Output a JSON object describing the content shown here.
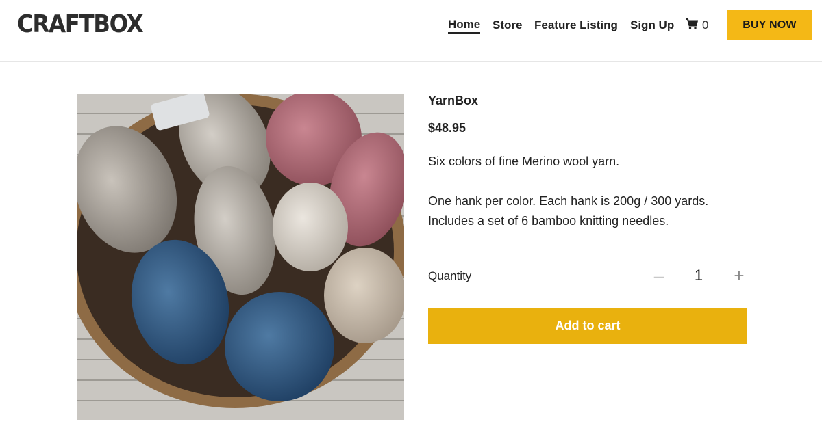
{
  "brand": {
    "logo_text": "CRAFTBOX"
  },
  "nav": {
    "items": [
      {
        "label": "Home"
      },
      {
        "label": "Store"
      },
      {
        "label": "Feature Listing"
      },
      {
        "label": "Sign Up"
      }
    ],
    "cart": {
      "icon": "cart-icon",
      "count": "0"
    },
    "buy_now_label": "BUY NOW"
  },
  "product": {
    "image_icon": "yarn-photo",
    "title": "YarnBox",
    "price": "$48.95",
    "description": [
      "Six colors of fine Merino wool yarn.",
      "One hank per color. Each hank is 200g / 300 yards. Includes a set of 6 bamboo knitting needles."
    ],
    "quantity": {
      "label": "Quantity",
      "value": "1",
      "minus": "–",
      "plus": "+"
    },
    "add_to_cart_label": "Add to cart"
  },
  "colors": {
    "accent": "#f4b816",
    "add_to_cart": "#e9b10e",
    "text": "#222222"
  }
}
